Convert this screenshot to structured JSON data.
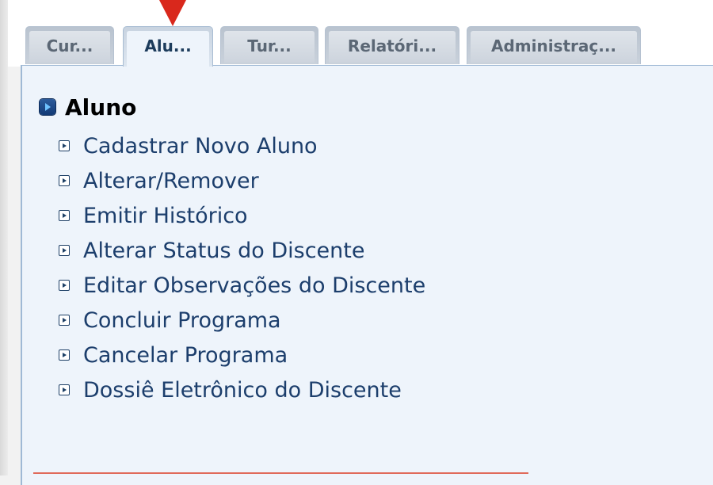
{
  "tabs": [
    {
      "label": "Cur...",
      "active": false
    },
    {
      "label": "Alu...",
      "active": true
    },
    {
      "label": "Tur...",
      "active": false
    },
    {
      "label": "Relatóri...",
      "active": false
    },
    {
      "label": "Administraç...",
      "active": false
    }
  ],
  "section": {
    "title": "Aluno",
    "items": [
      {
        "label": "Cadastrar Novo Aluno"
      },
      {
        "label": "Alterar/Remover"
      },
      {
        "label": "Emitir Histórico"
      },
      {
        "label": "Alterar Status do Discente"
      },
      {
        "label": "Editar Observações do Discente"
      },
      {
        "label": "Concluir Programa"
      },
      {
        "label": "Cancelar Programa"
      },
      {
        "label": "Dossiê Eletrônico do Discente"
      }
    ]
  },
  "colors": {
    "link": "#1c3e6c",
    "panel_bg": "#eef4fb",
    "pointer": "#d9281c",
    "highlight_line": "#e06a5a"
  },
  "icons": {
    "heading": "play-square-icon",
    "item": "play-outline-square-icon",
    "pointer": "down-arrow-indicator"
  }
}
